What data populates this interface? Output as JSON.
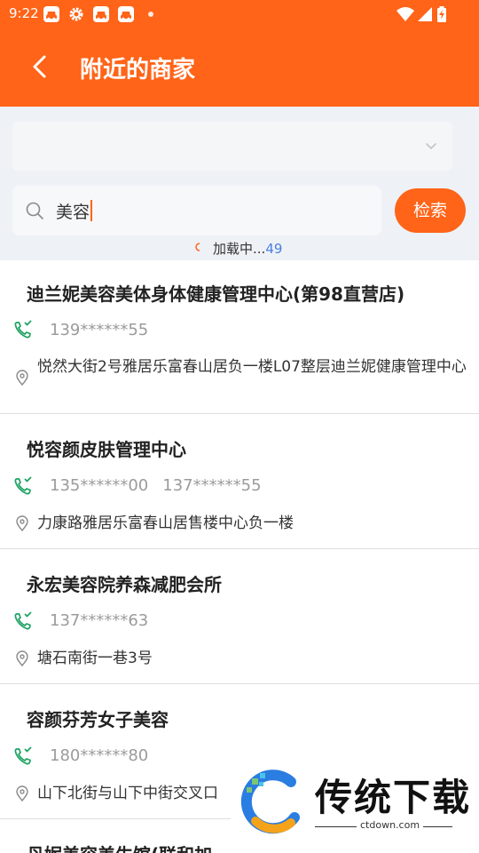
{
  "status_bar": {
    "time": "9:22",
    "notification_icons": [
      "car-app-icon",
      "settings-gear-icon",
      "car-app-icon",
      "car-app-icon"
    ],
    "system_icons": [
      "wifi-icon",
      "signal-icon",
      "battery-icon"
    ]
  },
  "header": {
    "title": "附近的商家"
  },
  "search": {
    "value": "美容",
    "button_label": "检索"
  },
  "loading": {
    "text": "加载中...",
    "count": "49"
  },
  "merchants": [
    {
      "name": "迪兰妮美容美体身体健康管理中心(第98直营店)",
      "phones": [
        "139******55"
      ],
      "address": "悦然大街2号雅居乐富春山居负一楼L07整层迪兰妮健康管理中心"
    },
    {
      "name": "悦容颜皮肤管理中心",
      "phones": [
        "135******00",
        "137******55"
      ],
      "address": "力康路雅居乐富春山居售楼中心负一楼"
    },
    {
      "name": "永宏美容院养森减肥会所",
      "phones": [
        "137******63"
      ],
      "address": "塘石南街一巷3号"
    },
    {
      "name": "容颜芬芳女子美容",
      "phones": [
        "180******80"
      ],
      "address": "山下北街与山下中街交叉口"
    },
    {
      "name": "丹妮美容美生馆(联和加",
      "phones": [],
      "address": ""
    }
  ],
  "watermark": {
    "title": "传统下载",
    "url": "ctdown.com"
  },
  "colors": {
    "brand_orange": "#ff6418",
    "icon_green": "#1aa260",
    "link_blue": "#4a7fe0"
  }
}
